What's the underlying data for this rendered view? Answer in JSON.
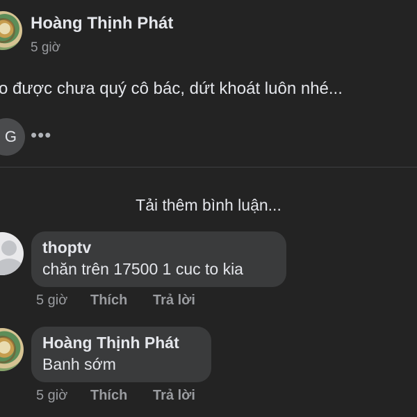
{
  "post": {
    "author": "Hoàng Thịnh Phát",
    "time": "5 giờ",
    "text": "o được chưa quý cô bác, dứt khoát luôn nhé...",
    "reactor_initial": "G",
    "more": "•••"
  },
  "load_more": "Tải thêm bình luận...",
  "comments": [
    {
      "author": "thoptv",
      "text": "chăn trên 17500 1 cuc to kia",
      "time": "5 giờ",
      "like": "Thích",
      "reply": "Trả lời"
    },
    {
      "author": "Hoàng Thịnh Phát",
      "text": "Banh sớm",
      "time": "5 giờ",
      "like": "Thích",
      "reply": "Trả lời"
    }
  ]
}
